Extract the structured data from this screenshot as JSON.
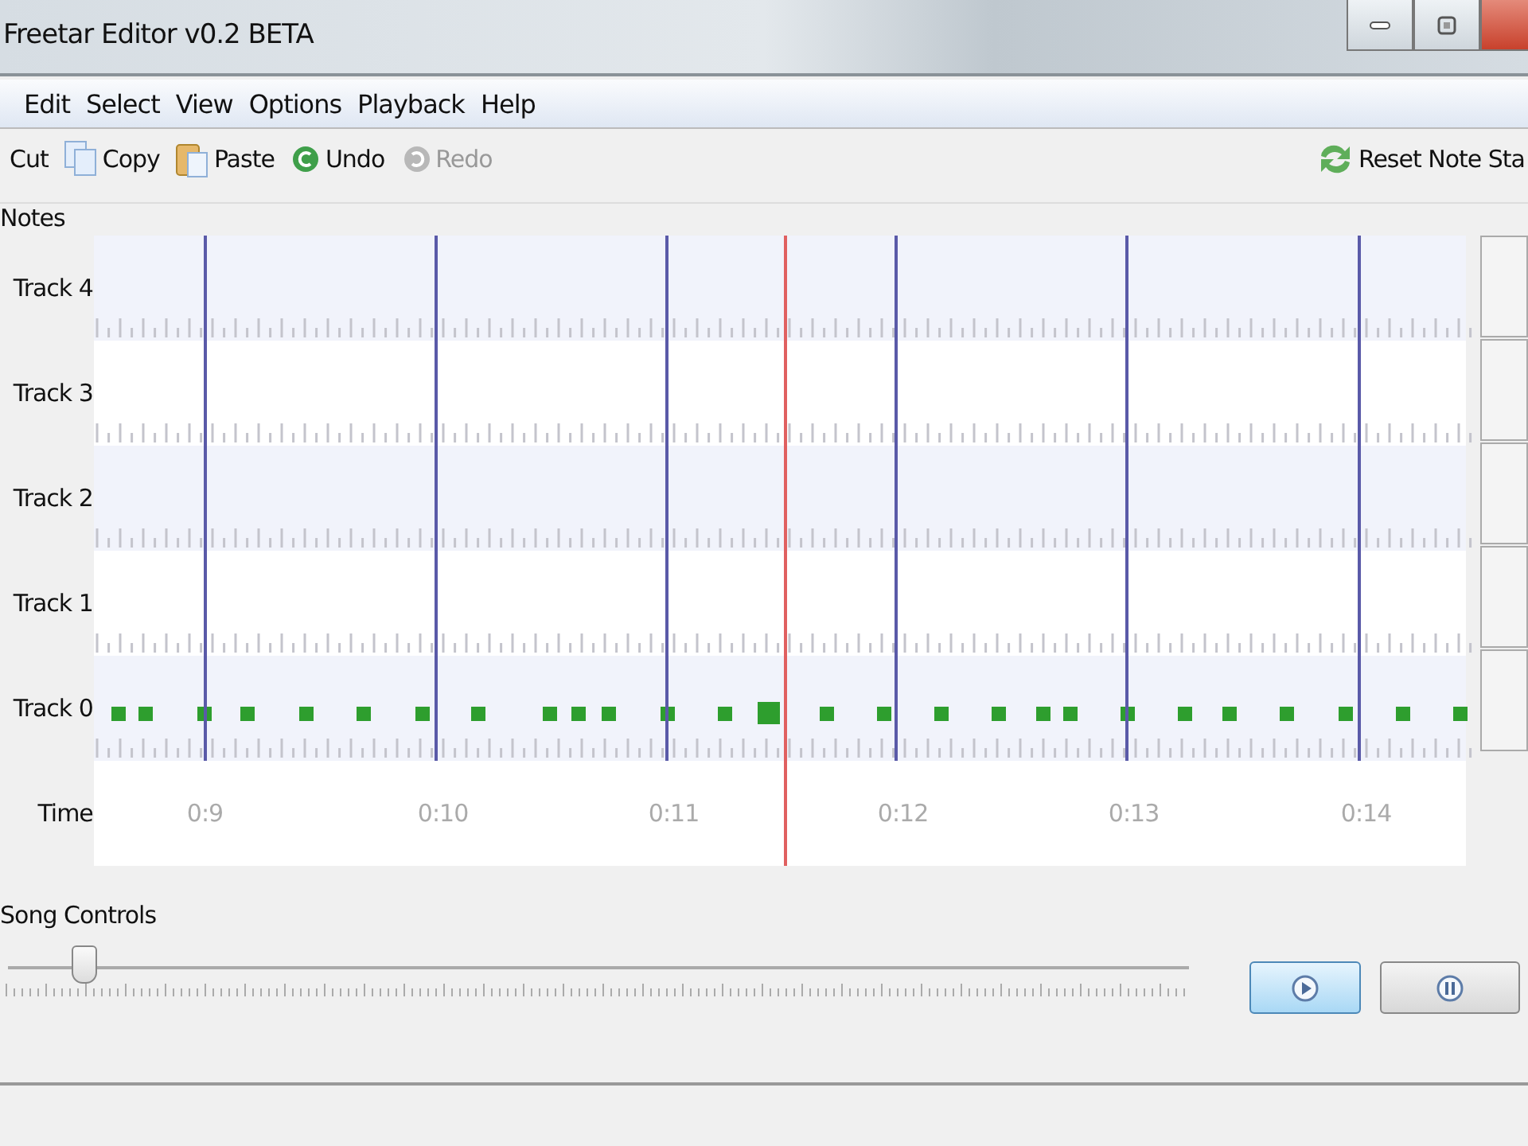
{
  "window": {
    "title": "Freetar Editor v0.2 BETA"
  },
  "menu": [
    "Edit",
    "Select",
    "View",
    "Options",
    "Playback",
    "Help"
  ],
  "toolbar": [
    {
      "kind": "cut",
      "label": "Cut",
      "disabled": false
    },
    {
      "kind": "copy",
      "label": "Copy",
      "disabled": false
    },
    {
      "kind": "paste",
      "label": "Paste",
      "disabled": false
    },
    {
      "kind": "undo",
      "label": "Undo",
      "disabled": false
    },
    {
      "kind": "redo",
      "label": "Redo",
      "disabled": true
    }
  ],
  "reset_button": {
    "label": "Reset Note Sta"
  },
  "notes": {
    "label": "Notes",
    "tracks": [
      "Track 4",
      "Track 3",
      "Track 2",
      "Track 1",
      "Track 0"
    ],
    "time_label": "Time",
    "time_marks": [
      "0:9",
      "0:10",
      "0:11",
      "0:12",
      "0:13",
      "0:14"
    ]
  },
  "song_controls": {
    "label": "Song Controls",
    "position": {
      "level": 0.06
    },
    "buttons": [
      {
        "kind": "play",
        "hover": true
      },
      {
        "kind": "pause",
        "hover": false
      }
    ]
  }
}
